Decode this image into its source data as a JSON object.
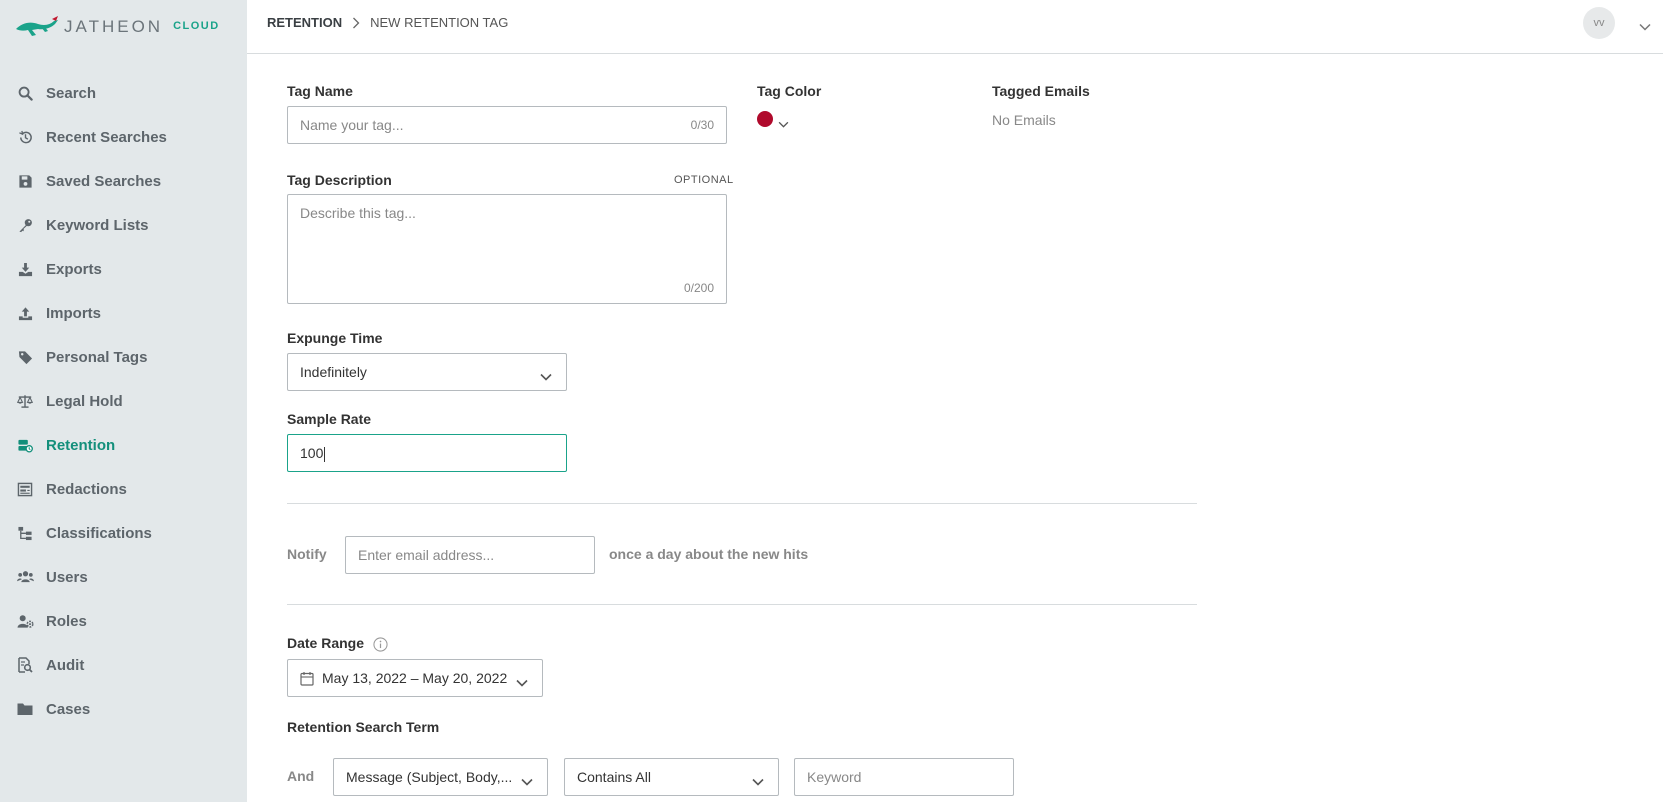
{
  "app": {
    "logo_text": "JATHEON",
    "logo_suffix": "CLOUD",
    "accent_color": "#138f7b"
  },
  "sidebar": {
    "items": [
      {
        "label": "Search",
        "icon": "search-icon"
      },
      {
        "label": "Recent Searches",
        "icon": "history-icon"
      },
      {
        "label": "Saved Searches",
        "icon": "save-icon"
      },
      {
        "label": "Keyword Lists",
        "icon": "key-icon"
      },
      {
        "label": "Exports",
        "icon": "download-icon"
      },
      {
        "label": "Imports",
        "icon": "upload-icon"
      },
      {
        "label": "Personal Tags",
        "icon": "tag-icon"
      },
      {
        "label": "Legal Hold",
        "icon": "scale-icon"
      },
      {
        "label": "Retention",
        "icon": "retention-icon",
        "active": true
      },
      {
        "label": "Redactions",
        "icon": "redaction-icon"
      },
      {
        "label": "Classifications",
        "icon": "hierarchy-icon"
      },
      {
        "label": "Users",
        "icon": "users-icon"
      },
      {
        "label": "Roles",
        "icon": "roles-icon"
      },
      {
        "label": "Audit",
        "icon": "audit-icon"
      },
      {
        "label": "Cases",
        "icon": "folder-icon"
      }
    ]
  },
  "header": {
    "breadcrumb_root": "RETENTION",
    "breadcrumb_current": "NEW RETENTION TAG",
    "user_initials": "vv"
  },
  "form": {
    "tag_name": {
      "label": "Tag Name",
      "placeholder": "Name your tag...",
      "counter": "0/30"
    },
    "tag_color": {
      "label": "Tag Color",
      "value": "#b00a2c"
    },
    "tagged_emails": {
      "label": "Tagged Emails",
      "value": "No Emails"
    },
    "tag_description": {
      "label": "Tag Description",
      "optional": "OPTIONAL",
      "placeholder": "Describe this tag...",
      "counter": "0/200"
    },
    "expunge_time": {
      "label": "Expunge Time",
      "value": "Indefinitely"
    },
    "sample_rate": {
      "label": "Sample Rate",
      "value": "100"
    },
    "notify": {
      "label": "Notify",
      "placeholder": "Enter email address...",
      "suffix": "once a day about the new hits"
    },
    "date_range": {
      "label": "Date Range",
      "value": "May 13, 2022 – May 20, 2022"
    },
    "search_term": {
      "label": "Retention Search Term",
      "operator": "And",
      "field": "Message (Subject, Body,...",
      "condition": "Contains All",
      "keyword_placeholder": "Keyword"
    }
  }
}
